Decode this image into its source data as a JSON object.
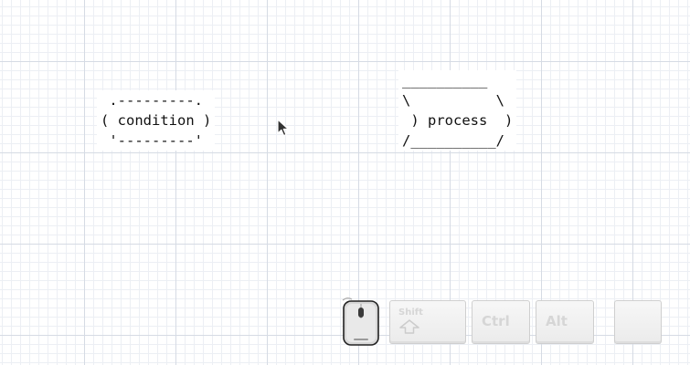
{
  "diagram": {
    "shapes": [
      {
        "kind": "condition",
        "ascii": " .---------.\n( condition )\n '---------'"
      },
      {
        "kind": "process",
        "ascii": "__________\n\\          \\\n ) process  )\n/__________/"
      }
    ]
  },
  "key_overlay": {
    "shift_label": "Shift",
    "ctrl_label": "Ctrl",
    "alt_label": "Alt",
    "blank_label": ""
  },
  "icons": {
    "cursor": "arrow-pointer-icon",
    "mouse": "mouse-icon",
    "shift_arrow": "shift-arrow-icon"
  }
}
